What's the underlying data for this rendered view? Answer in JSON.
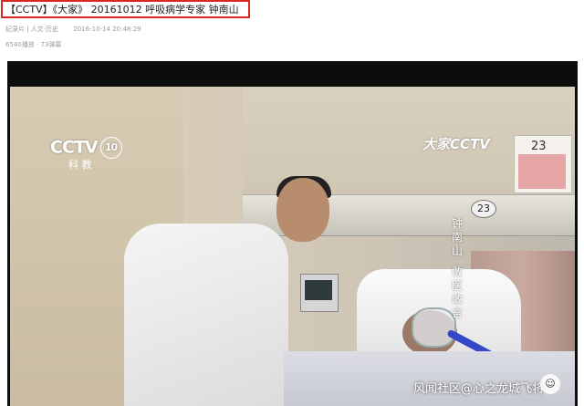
{
  "article": {
    "title": "【CCTV】《大家》 20161012 呼吸病学专家 钟南山",
    "category": "纪录片 | 人文·历史",
    "timestamp": "2016-10-14 20:48:29",
    "stats": "6540播放 · 73弹幕"
  },
  "video": {
    "channel_logo": "CCTV",
    "channel_number": "10",
    "channel_name": "科 教",
    "program_logo": "大家CCTV",
    "bed_number": "23",
    "calendar_number": "23",
    "caption_name": "钟南山",
    "caption_role": "敢医敢言"
  },
  "watermark": {
    "text": "风闻社区@心之龙城飞将",
    "icon": "avatar-icon"
  },
  "colors": {
    "title_border": "#d9281f",
    "player_bg": "#0d0d0d",
    "tube": "#3548c9"
  }
}
